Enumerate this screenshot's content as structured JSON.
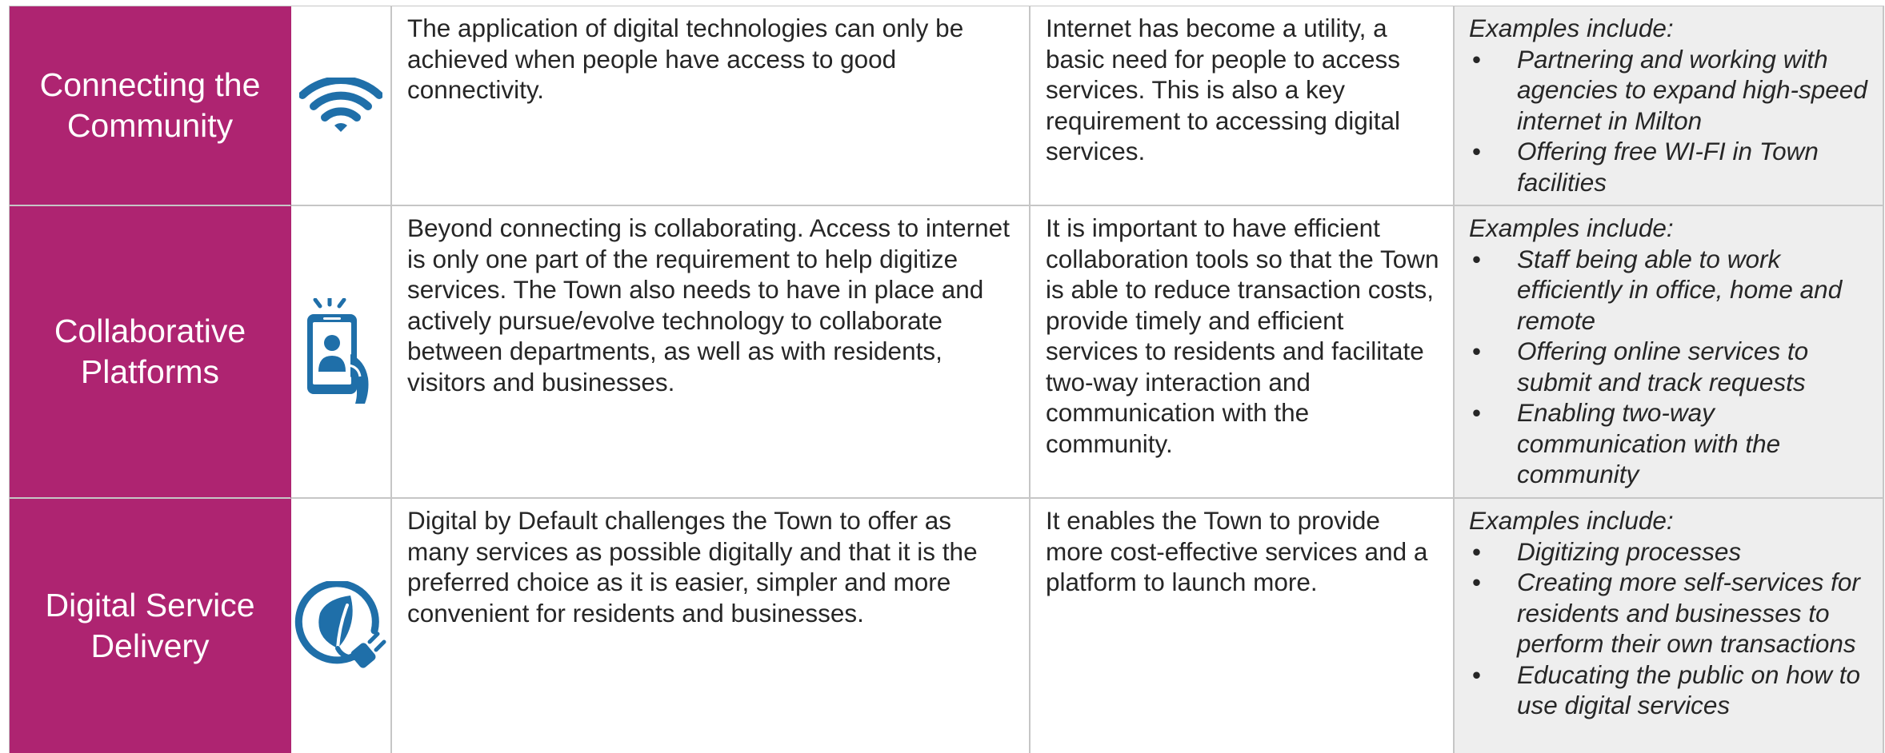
{
  "rows": [
    {
      "title": "Connecting the\nCommunity",
      "icon": "wifi-icon",
      "description": "The application of digital technologies can only be achieved when people have access to good connectivity.",
      "rationale": "Internet has become a utility, a basic need for people to access services. This is also a key requirement to accessing digital services.",
      "examples_heading": "Examples include:",
      "examples": [
        "Partnering and working with agencies to expand high-speed internet in Milton",
        "Offering free WI-FI in Town facilities"
      ]
    },
    {
      "title": "Collaborative\nPlatforms",
      "icon": "smartphone-user-icon",
      "description": "Beyond connecting is collaborating. Access to internet is only one part of the requirement to help digitize services. The Town also needs to have in place and actively pursue/evolve technology to collaborate between departments, as well as with residents, visitors and businesses.",
      "rationale": "It is important to have efficient collaboration tools so that the Town is able to reduce transaction costs, provide timely and efficient services to residents and facilitate two-way interaction and communication with the community.",
      "examples_heading": "Examples include:",
      "examples": [
        "Staff being able to work efficiently in office, home and remote",
        "Offering online services to submit and track requests",
        "Enabling  two-way communication with the community"
      ]
    },
    {
      "title": "Digital Service\nDelivery",
      "icon": "leaf-plug-icon",
      "description": "Digital by Default challenges the Town to offer as many services as possible digitally and that it is the preferred choice as it is easier, simpler and more convenient for residents and businesses.",
      "rationale": "It enables the Town to provide more cost-effective services and a platform to launch more.",
      "examples_heading": "Examples include:",
      "examples": [
        "Digitizing processes",
        "Creating more self-services for residents and businesses to perform their own transactions",
        "Educating the public on how to use digital services"
      ]
    }
  ],
  "colors": {
    "title_background": "#ae2471",
    "title_text": "#ffffff",
    "icon_blue": "#1f6fa9",
    "examples_background": "#eeeeee",
    "grid_line": "#c6c6c6"
  }
}
